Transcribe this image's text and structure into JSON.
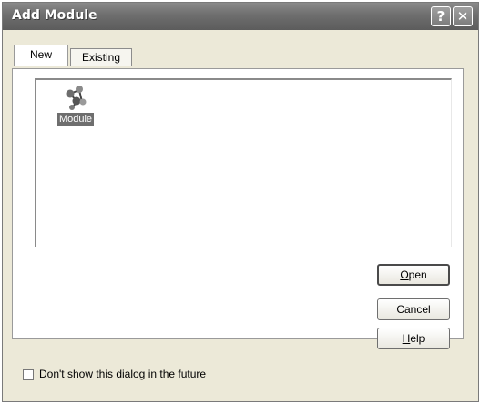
{
  "window": {
    "title": "Add Module",
    "help_glyph": "?",
    "close_glyph": "✕"
  },
  "tabs": [
    {
      "label": "New",
      "selected": true
    },
    {
      "label": "Existing",
      "selected": false
    }
  ],
  "list": {
    "items": [
      {
        "label": "Module",
        "icon": "module-icon",
        "selected": true
      }
    ]
  },
  "buttons": {
    "open": {
      "mnemonic": "O",
      "rest": "pen"
    },
    "cancel": "Cancel",
    "help": {
      "mnemonic": "H",
      "rest": "elp"
    }
  },
  "footer": {
    "checkbox_pre": "Don't show this dialog in the f",
    "checkbox_mnemonic": "u",
    "checkbox_post": "ture",
    "checked": false
  }
}
